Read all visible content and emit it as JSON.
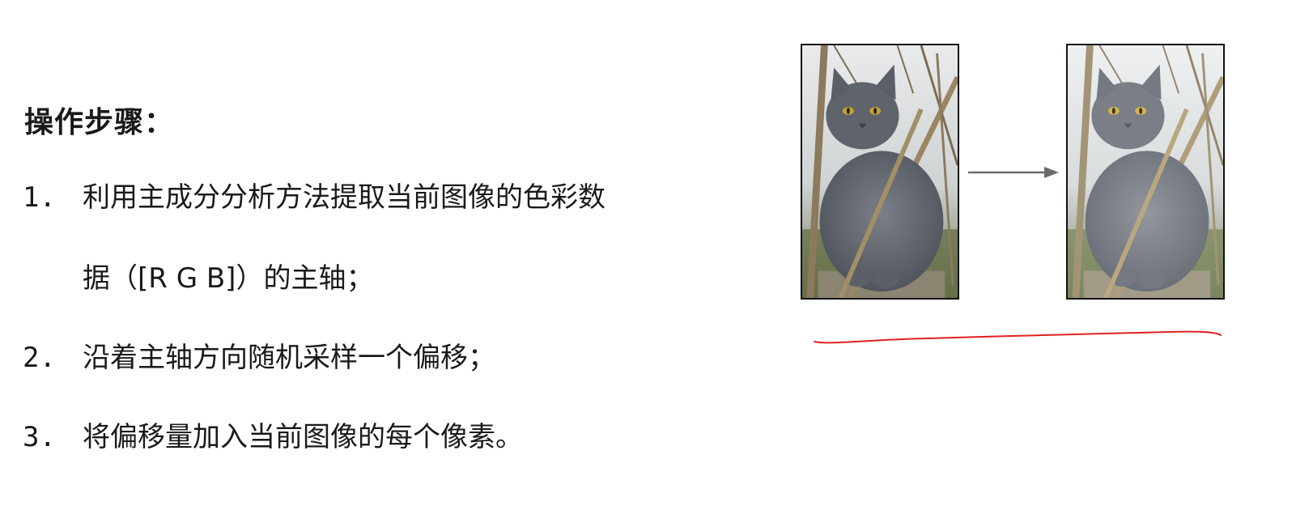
{
  "heading": "操作步骤：",
  "steps": [
    {
      "number": "1.",
      "text": "利用主成分分析方法提取当前图像的色彩数",
      "continuation": "据（[R G B]）的主轴；"
    },
    {
      "number": "2.",
      "text": "沿着主轴方向随机采样一个偏移；"
    },
    {
      "number": "3.",
      "text": "将偏移量加入当前图像的每个像素。"
    }
  ],
  "figure": {
    "original_image": "cat-photo-original",
    "augmented_image": "cat-photo-color-shifted",
    "arrow_icon": "arrow-right-icon",
    "annotation_color": "#e02020"
  }
}
